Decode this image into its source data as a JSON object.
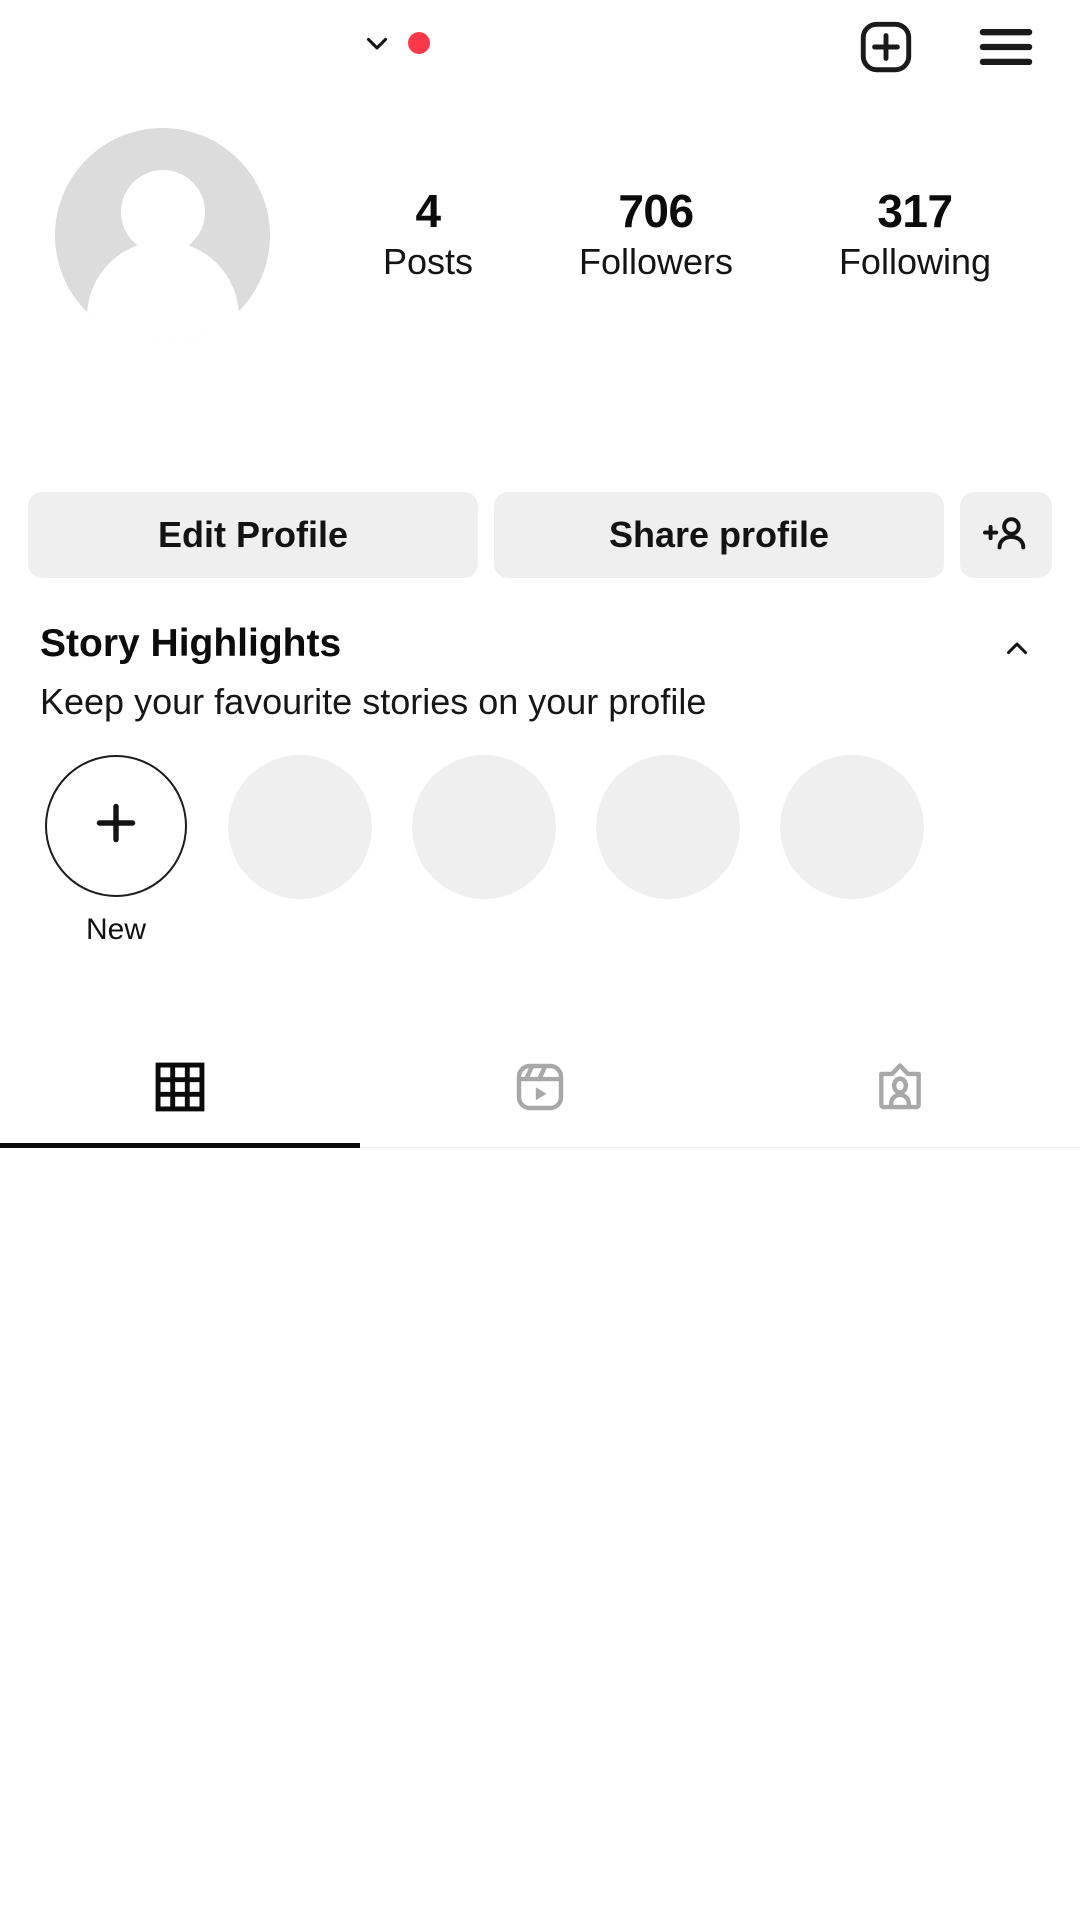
{
  "app": {
    "name": "Instagram",
    "screen": "profile"
  },
  "topbar": {
    "username": "",
    "account_switch_icon": "chevron-down-icon",
    "notification_dot": true,
    "notification_color": "#f9394a",
    "new_post_label": "",
    "new_post_icon": "plus-square-icon",
    "menu_icon": "hamburger-menu-icon"
  },
  "profile": {
    "avatar_icon": "default-avatar-placeholder",
    "display_name": "",
    "stats": [
      {
        "value": "4",
        "label": "Posts"
      },
      {
        "value": "706",
        "label": "Followers"
      },
      {
        "value": "317",
        "label": "Following"
      }
    ]
  },
  "actions": {
    "edit_profile_label": "Edit Profile",
    "share_profile_label": "Share profile",
    "discover_people_icon": "add-person-icon"
  },
  "highlights": {
    "title": "Story Highlights",
    "subtitle": "Keep your favourite stories on your profile",
    "collapse_icon": "chevron-up-icon",
    "new_label": "New",
    "new_icon": "plus-icon",
    "placeholder_count": 4
  },
  "tabs": [
    {
      "name": "grid",
      "icon": "grid-icon",
      "active": true
    },
    {
      "name": "reels",
      "icon": "reels-icon",
      "active": false
    },
    {
      "name": "tagged",
      "icon": "tagged-person-icon",
      "active": false
    }
  ],
  "colors": {
    "background": "#ffffff",
    "text_primary": "#0b0b0b",
    "button_bg": "#efefef",
    "placeholder_gray": "#efefef",
    "avatar_gray": "#dcdcdc",
    "accent_red": "#f9394a",
    "tab_inactive": "#a8a8a8"
  }
}
